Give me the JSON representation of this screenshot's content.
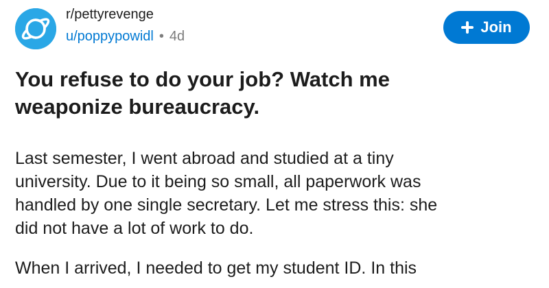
{
  "post": {
    "subreddit": "r/pettyrevenge",
    "username": "u/poppypowidl",
    "separator": "•",
    "age": "4d",
    "join_label": "Join",
    "title_line1": "You refuse to do your job? Watch me",
    "title_line2": "weaponize bureaucracy.",
    "body": {
      "p1": [
        "Last semester, I went abroad and studied at a tiny",
        "university. Due to it being so small, all paperwork was",
        "handled by one single secretary. Let me stress this: she",
        "did not have a lot of work to do."
      ],
      "p2": [
        "When I arrived, I needed to get my student ID. In this"
      ]
    }
  },
  "colors": {
    "accent": "#0079d3",
    "avatar": "#2aa7e6",
    "text": "#1c1c1c",
    "muted": "#7c7c7c"
  },
  "icons": {
    "avatar": "subreddit-planet-icon",
    "join": "plus-icon"
  }
}
